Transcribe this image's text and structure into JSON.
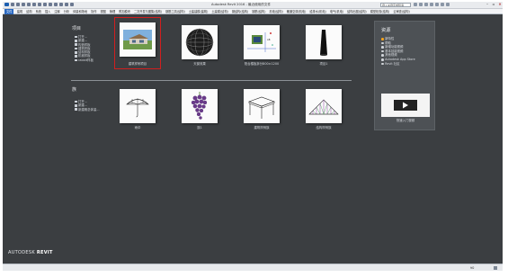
{
  "window": {
    "title": "Autodesk Revit 2016 - 最近使用的文件",
    "search_value": "键入关键字或短语"
  },
  "ribbon_tabs": [
    "文件",
    "建筑",
    "结构",
    "系统",
    "插入",
    "注释",
    "分析",
    "体量和场地",
    "协作",
    "视图",
    "管理",
    "附加模块",
    "二次开发与图集(结构)",
    "钢筋工具(结构)",
    "土建建模(建筑)",
    "土建模(结构)",
    "钢结构(结构)",
    "钢筋(结构)",
    "机电(结构)",
    "暖通空调(机电)",
    "给排水(机电)",
    "电气(机电)",
    "结构出图(结构)",
    "模型检查(结构)",
    "云审查(结构)"
  ],
  "projects": {
    "title": "项目",
    "links": [
      "打开...",
      "新建...",
      "构造样板",
      "建筑样板",
      "结构样板",
      "机械样板",
      "rabbit样板"
    ]
  },
  "families": {
    "title": "族",
    "links": [
      "打开...",
      "新建...",
      "新建概念体量..."
    ]
  },
  "recent_projects": [
    {
      "caption": "建筑样例项目",
      "kind": "house"
    },
    {
      "caption": "天窗效果",
      "kind": "sphere"
    },
    {
      "caption": "阳台楼板拆分800×1200",
      "kind": "drawing"
    },
    {
      "caption": "项目1",
      "kind": "tower"
    }
  ],
  "recent_families": [
    {
      "caption": "雨伞",
      "kind": "umbrella"
    },
    {
      "caption": "族1",
      "kind": "grapes"
    },
    {
      "caption": "建筑样例族",
      "kind": "table"
    },
    {
      "caption": "结构样例族",
      "kind": "truss"
    }
  ],
  "resources": {
    "title": "资源",
    "items": [
      {
        "label": "新特性",
        "bullet": "#f2a11b"
      },
      {
        "label": "帮助",
        "bullet": "#d0d4d9"
      },
      {
        "label": "新增功能视频",
        "bullet": "#d0d4d9"
      },
      {
        "label": "基本技能视频",
        "bullet": "#d0d4d9"
      },
      {
        "label": "其他视频",
        "bullet": "#d0d4d9"
      },
      {
        "label": "Autodesk App Store",
        "bullet": "#d0d4d9"
      },
      {
        "label": "Revit 社区",
        "bullet": "#d0d4d9"
      }
    ],
    "video_caption": "快速入门视频"
  },
  "brand": {
    "autodesk": "AUTODESK",
    "product": "REVIT"
  },
  "statusbar": {
    "text": "∀0"
  },
  "colors": {
    "background": "#3b3e41",
    "selection": "#d11f1f",
    "active_tab": "#2d6bc2"
  },
  "icons": [
    "revit-logo-icon",
    "open-icon",
    "new-icon",
    "template-icon",
    "play-icon",
    "filter-icon"
  ]
}
